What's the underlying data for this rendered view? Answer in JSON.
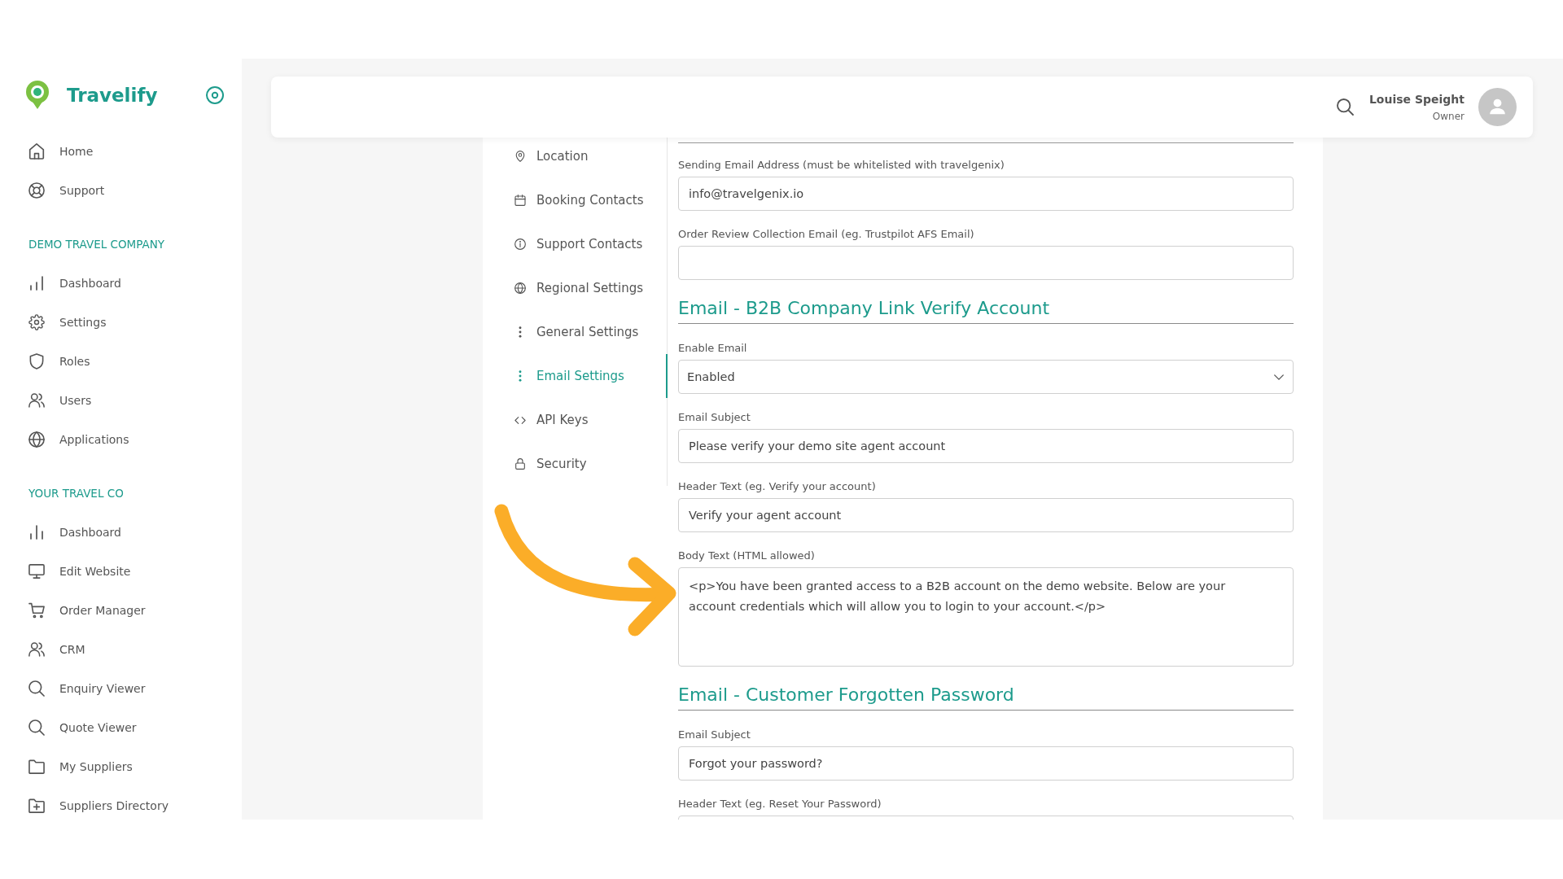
{
  "sidebar": {
    "brand": "Travelify",
    "items": [
      "Home",
      "Support"
    ],
    "sections": [
      {
        "title": "DEMO TRAVEL COMPANY",
        "items": [
          "Dashboard",
          "Settings",
          "Roles",
          "Users",
          "Applications"
        ]
      },
      {
        "title": "YOUR TRAVEL CO",
        "items": [
          "Dashboard",
          "Edit Website",
          "Order Manager",
          "CRM",
          "Enquiry Viewer",
          "Quote Viewer",
          "My Suppliers",
          "Suppliers Directory"
        ]
      }
    ]
  },
  "top_bar": {
    "user_name": "Louise Speight",
    "user_role": "Owner"
  },
  "settings_nav": {
    "items": [
      {
        "label": "Location",
        "selected": false
      },
      {
        "label": "Booking Contacts",
        "selected": false
      },
      {
        "label": "Support Contacts",
        "selected": false
      },
      {
        "label": "Regional Settings",
        "selected": false
      },
      {
        "label": "General Settings",
        "selected": false
      },
      {
        "label": "Email Settings",
        "selected": true
      },
      {
        "label": "API Keys",
        "selected": false
      },
      {
        "label": "Security",
        "selected": false
      }
    ]
  },
  "email_form": {
    "fields": [
      {
        "kind": "text",
        "label": "Sending Email Address (must be whitelisted with travelgenix)",
        "value": "info@travelgenix.io"
      },
      {
        "kind": "text",
        "label": "Order Review Collection Email (eg. Trustpilot AFS Email)"
      }
    ],
    "sections": [
      {
        "title": "Email - B2B Company Link Verify Account",
        "fields": [
          {
            "kind": "select",
            "label": "Enable Email",
            "value": "Enabled"
          },
          {
            "kind": "text",
            "label": "Email Subject",
            "value": "Please verify your demo site agent account"
          },
          {
            "kind": "text",
            "label": "Header Text (eg. Verify your account)",
            "value": "Verify your agent account"
          },
          {
            "kind": "textarea",
            "label": "Body Text (HTML allowed)",
            "value": "<p>You have been granted access to a B2B account on the demo website. Below are your account credentials which will allow you to login to your account.</p>"
          }
        ]
      },
      {
        "title": "Email - Customer Forgotten Password",
        "fields": [
          {
            "kind": "text",
            "label": "Email Subject",
            "value": "Forgot your password?"
          },
          {
            "kind": "text",
            "label": "Header Text (eg. Reset Your Password)"
          }
        ]
      }
    ]
  }
}
